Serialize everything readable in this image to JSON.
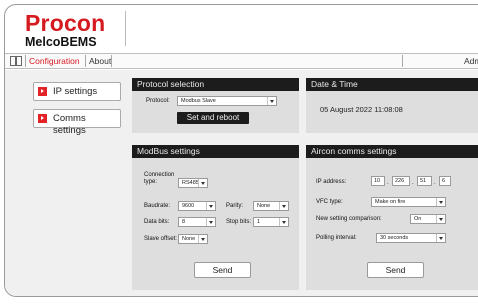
{
  "brand": {
    "name": "Procon",
    "product": "MelcoBEMS"
  },
  "menu": {
    "configuration": "Configuration",
    "about": "About",
    "admin": "Admi"
  },
  "nav": {
    "ip_settings": "IP settings",
    "comms_settings": "Comms settings"
  },
  "protocol": {
    "title": "Protocol selection",
    "label": "Protocol:",
    "value": "Modbus Slave",
    "reboot_button": "Set and reboot"
  },
  "datetime": {
    "title": "Date & Time",
    "value": "05 August 2022 11:08:08"
  },
  "modbus": {
    "title": "ModBus settings",
    "connection_type_label": "Connection type:",
    "connection_type": "RS485",
    "baudrate_label": "Baudrate:",
    "baudrate": "9600",
    "parity_label": "Parity:",
    "parity": "None",
    "data_bits_label": "Data bits:",
    "data_bits": "8",
    "stop_bits_label": "Stop bits:",
    "stop_bits": "1",
    "slave_offset_label": "Slave offset:",
    "slave_offset": "None",
    "send_button": "Send"
  },
  "aircon": {
    "title": "Aircon comms settings",
    "ip_label": "IP address:",
    "ip": [
      "10",
      "226",
      "51",
      "6"
    ],
    "vfc_label": "VFC type:",
    "vfc": "Make on fire",
    "comparison_label": "New setting comparison:",
    "comparison": "On",
    "polling_label": "Polling interval:",
    "polling": "30 seconds",
    "send_button": "Send"
  },
  "colors": {
    "brand_red": "#d61b20",
    "panel_header": "#1c1c1c",
    "panel_body": "#dedede"
  }
}
